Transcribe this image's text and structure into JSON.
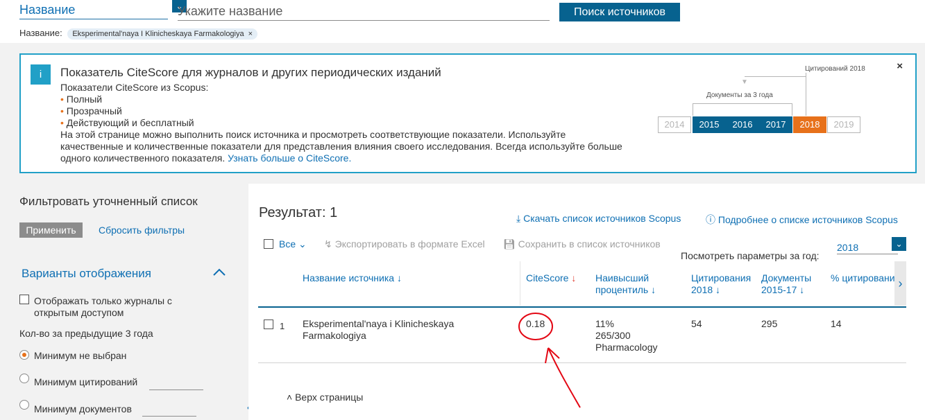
{
  "search": {
    "field_type": "Название",
    "placeholder": "Укажите название",
    "button": "Поиск источников",
    "filter_label": "Название:",
    "chip": "Eksperimental'naya I Klinicheskaya Farmakologiya",
    "chip_close": "×"
  },
  "info": {
    "badge": "i",
    "title": "Показатель CiteScore для журналов и других периодических изданий",
    "subtitle": "Показатели CiteScore из Scopus:",
    "bullets": [
      "Полный",
      "Прозрачный",
      "Действующий и бесплатный"
    ],
    "body": "На этой странице можно выполнить поиск источника и просмотреть соответствующие показатели. Используйте качественные и количественные показатели для представления влияния своего исследования. Всегда используйте больше одного количественного показателя.",
    "link": "Узнать больше о CiteScore.",
    "close": "×",
    "diagram": {
      "citations_label": "Цитирований 2018",
      "documents_label": "Документы за 3 года",
      "years": [
        "2014",
        "2015",
        "2016",
        "2017",
        "2018",
        "2019"
      ]
    }
  },
  "sidebar": {
    "title": "Фильтровать уточненный список",
    "apply": "Применить",
    "reset": "Сбросить фильтры",
    "options_title": "Варианты отображения",
    "open_access": "Отображать только журналы с открытым доступом",
    "count_label": "Кол-во за предыдущие 3 года",
    "radios": [
      "Минимум не выбран",
      "Минимум цитирований",
      "Минимум документов"
    ],
    "collapse": "«"
  },
  "results": {
    "title": "Результат: 1",
    "download": "Скачать список источников Scopus",
    "more": "Подробнее о списке источников Scopus",
    "all": "Все",
    "export": "Экспортировать в формате Excel",
    "save": "Сохранить в список источников",
    "year_label": "Посмотреть параметры за год:",
    "year_value": "2018",
    "columns": {
      "name": "Название источника",
      "citescore": "CiteScore",
      "percentile_1": "Наивысший",
      "percentile_2": "процентиль",
      "citations_1": "Цитирования",
      "citations_2": "2018",
      "documents_1": "Документы",
      "documents_2": "2015-17",
      "percent": "% цитирования"
    },
    "row": {
      "num": "1",
      "name_1": "Eksperimental'naya i Klinicheskaya",
      "name_2": "Farmakologiya",
      "citescore": "0.18",
      "percentile_1": "11%",
      "percentile_2": "265/300",
      "percentile_3": "Pharmacology",
      "citations": "54",
      "documents": "295",
      "percent": "14"
    },
    "top_link": "Верх страницы"
  },
  "colors": {
    "accent": "#07628f",
    "link": "#0e6fb3",
    "orange": "#e7711b",
    "annotation_red": "#e30613"
  }
}
